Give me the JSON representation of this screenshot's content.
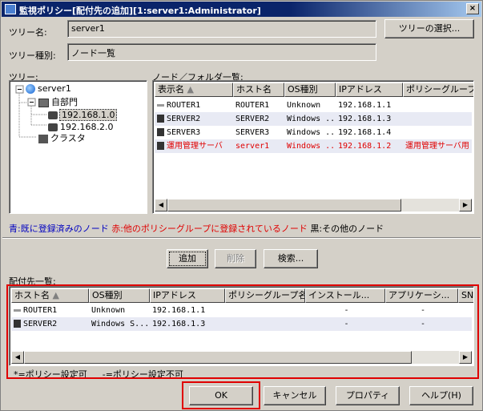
{
  "window": {
    "title": "監視ポリシー[配付先の追加][1:server1:Administrator]",
    "close_glyph": "×"
  },
  "tree_name": {
    "label": "ツリー名:",
    "value": "server1",
    "button": "ツリーの選択..."
  },
  "tree_type": {
    "label": "ツリー種別:",
    "value": "ノード一覧"
  },
  "tree": {
    "label": "ツリー:",
    "items": [
      "server1",
      "自部門",
      "192.168.1.0",
      "192.168.2.0",
      "クラスタ"
    ]
  },
  "node_list": {
    "label": "ノード／フォルダ一覧:",
    "columns": [
      "表示名",
      "ホスト名",
      "OS種別",
      "IPアドレス",
      "ポリシーグループ"
    ],
    "rows": [
      {
        "display": "ROUTER1",
        "host": "ROUTER1",
        "os": "Unknown",
        "ip": "192.168.1.1",
        "group": ""
      },
      {
        "display": "SERVER2",
        "host": "SERVER2",
        "os": "Windows ...",
        "ip": "192.168.1.3",
        "group": ""
      },
      {
        "display": "SERVER3",
        "host": "SERVER3",
        "os": "Windows ...",
        "ip": "192.168.1.4",
        "group": ""
      },
      {
        "display": "運用管理サーバ",
        "host": "server1",
        "os": "Windows ...",
        "ip": "192.168.1.2",
        "group": "運用管理サーバ用"
      }
    ]
  },
  "legend": {
    "blue": "青:既に登録済みのノード",
    "red": "赤:他のポリシーグループに登録されているノード",
    "black": "黒:その他のノード"
  },
  "actions": {
    "add": "追加",
    "delete": "削除",
    "search": "検索..."
  },
  "dest_list": {
    "label": "配付先一覧:",
    "columns": [
      "ホスト名",
      "OS種別",
      "IPアドレス",
      "ポリシーグループ名",
      "インストール...",
      "アプリケーシ...",
      "SNMP"
    ],
    "rows": [
      {
        "host": "ROUTER1",
        "os": "Unknown",
        "ip": "192.168.1.1",
        "group": "",
        "install": "-",
        "app": "-"
      },
      {
        "host": "SERVER2",
        "os": "Windows S...",
        "ip": "192.168.1.3",
        "group": "",
        "install": "-",
        "app": "-"
      }
    ]
  },
  "policy_note": {
    "settable": "*=ポリシー設定可",
    "not_settable": "-=ポリシー設定不可"
  },
  "footer": {
    "ok": "OK",
    "cancel": "キャンセル",
    "properties": "プロパティ",
    "help": "ヘルプ(H)"
  },
  "colors": {
    "highlight": "#e00000",
    "title_bar": "#0a246a",
    "registered_blue": "#0000c0"
  }
}
